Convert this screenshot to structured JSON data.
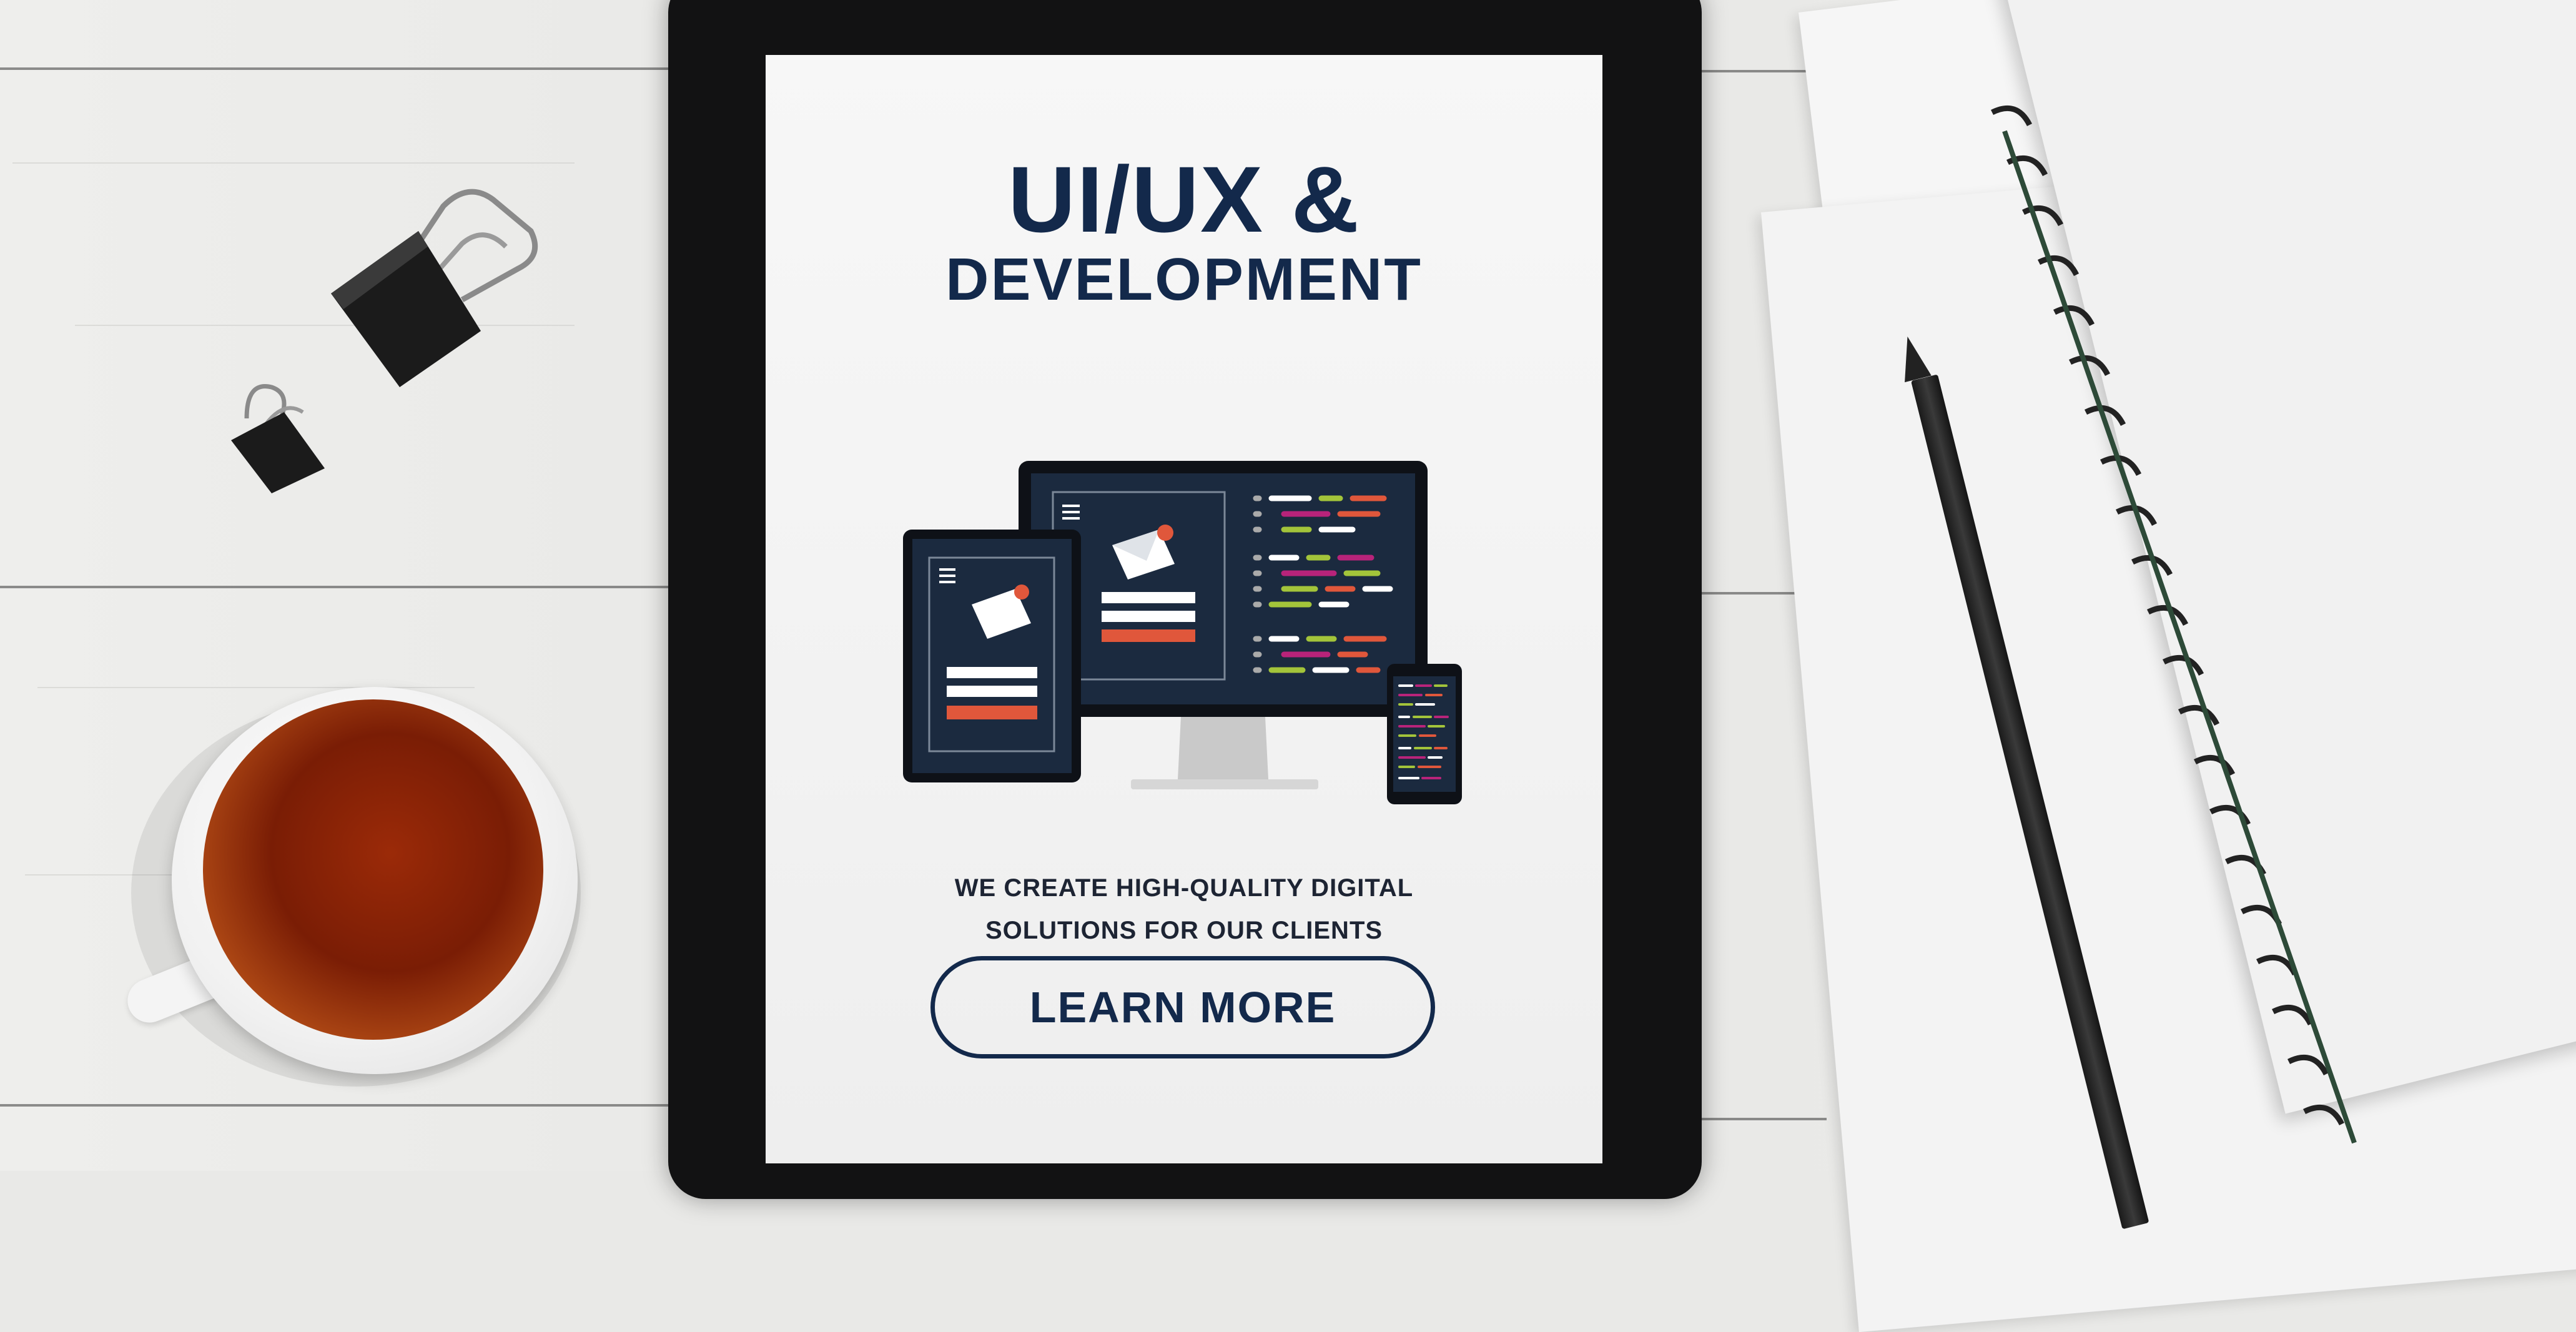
{
  "scene": {
    "colors": {
      "desk": "#ececea",
      "tablet_bezel": "#121213",
      "brand_navy": "#13294b",
      "accent_red": "#e0573b",
      "accent_green": "#a3c43a",
      "accent_magenta": "#b8237a"
    }
  },
  "screen": {
    "title_line1": "UI/UX &",
    "title_line2": "DEVELOPMENT",
    "tagline_line1": "WE CREATE HIGH-QUALITY DIGITAL",
    "tagline_line2": "SOLUTIONS FOR OUR CLIENTS",
    "cta_label": "LEARN MORE",
    "illustration": {
      "monitor_icon": "monitor-icon",
      "tablet_icon": "tablet-icon",
      "phone_icon": "phone-icon",
      "mail_icon": "envelope-icon",
      "notification_count": "1"
    }
  }
}
